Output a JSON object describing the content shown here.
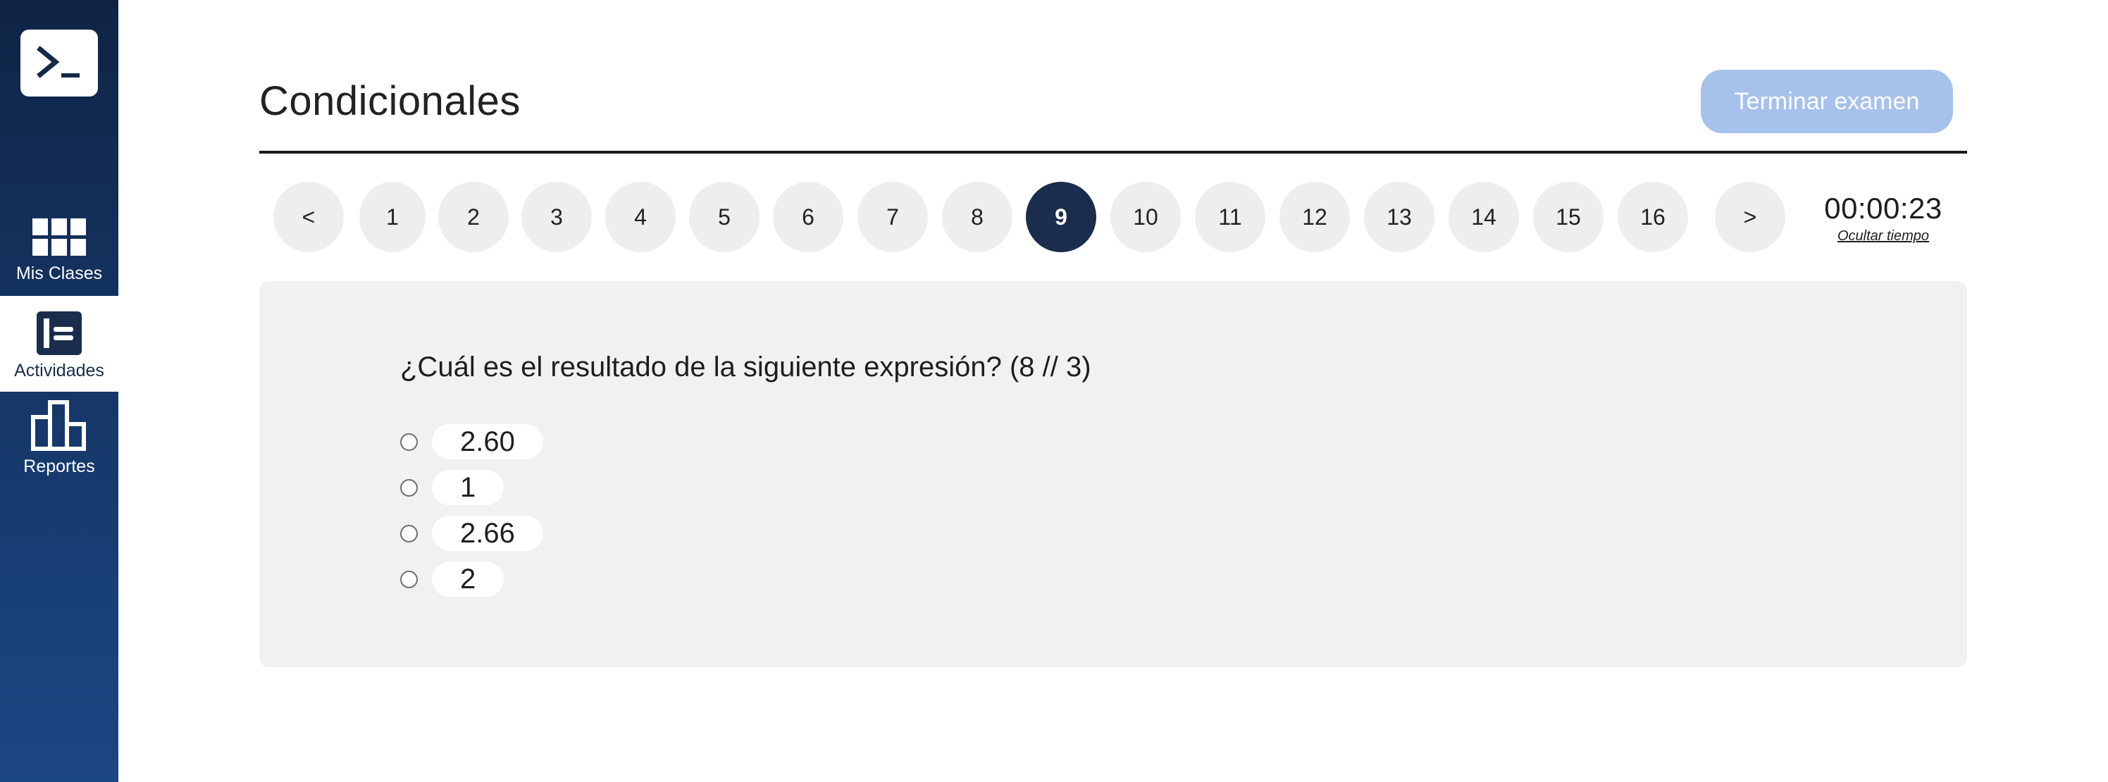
{
  "sidebar": {
    "logo_icon": "terminal-prompt-icon",
    "items": [
      {
        "label": "Mis Clases",
        "icon": "grid-icon",
        "active": false
      },
      {
        "label": "Actividades",
        "icon": "activity-list-icon",
        "active": true
      },
      {
        "label": "Reportes",
        "icon": "bar-chart-icon",
        "active": false
      }
    ]
  },
  "header": {
    "title": "Condicionales",
    "finish_button": "Terminar examen"
  },
  "question_nav": {
    "prev_label": "<",
    "next_label": ">",
    "numbers": [
      "1",
      "2",
      "3",
      "4",
      "5",
      "6",
      "7",
      "8",
      "9",
      "10",
      "11",
      "12",
      "13",
      "14",
      "15",
      "16"
    ],
    "current": "9"
  },
  "timer": {
    "value": "00:00:23",
    "hide_label": "Ocultar tiempo"
  },
  "question": {
    "text": "¿Cuál es el resultado de la siguiente expresión? (8 // 3)",
    "options": [
      "2.60",
      "1",
      "2.66",
      "2"
    ]
  },
  "colors": {
    "sidebar_top": "#0f2445",
    "sidebar_bottom": "#1b4684",
    "current_question": "#1a2d4d",
    "finish_button": "#a7c1ed",
    "panel_background": "#f2f1f1"
  }
}
